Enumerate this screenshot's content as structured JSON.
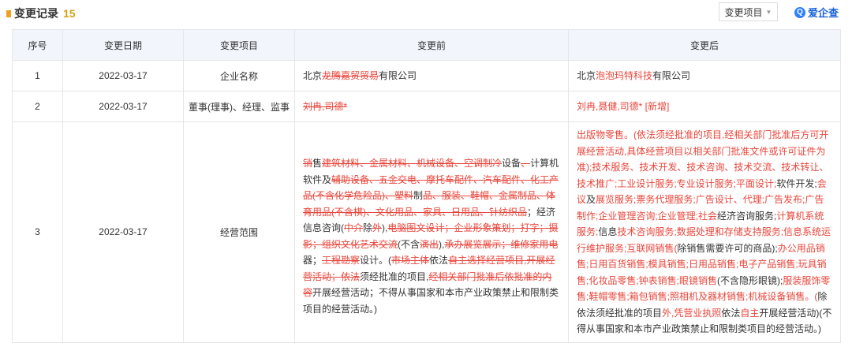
{
  "header": {
    "title": "变更记录",
    "count": "15",
    "filter_label": "变更项目",
    "brand_name": "爱企查",
    "brand_icon": "search-magnifier-icon"
  },
  "table": {
    "columns": [
      "序号",
      "变更日期",
      "变更项目",
      "变更前",
      "变更后"
    ],
    "rows": [
      {
        "no": "1",
        "date": "2022-03-17",
        "item": "企业名称",
        "before": [
          [
            "n",
            "北京"
          ],
          [
            "d",
            "龙腾嘉贸贸易"
          ],
          [
            "n",
            "有限公司"
          ]
        ],
        "after": [
          [
            "n",
            "北京"
          ],
          [
            "r",
            "泡泡玛特科技"
          ],
          [
            "n",
            "有限公司"
          ]
        ]
      },
      {
        "no": "2",
        "date": "2022-03-17",
        "item": "董事(理事)、经理、监事",
        "before": [
          [
            "d",
            "刘冉,司德*"
          ]
        ],
        "after": [
          [
            "r",
            "刘冉,聂健,司德* [新增]"
          ]
        ]
      },
      {
        "no": "3",
        "date": "2022-03-17",
        "item": "经营范围",
        "before": [
          [
            "d",
            "销"
          ],
          [
            "n",
            "售"
          ],
          [
            "d",
            "建筑材料、金属材料、机械设备、空调制冷"
          ],
          [
            "n",
            "设备"
          ],
          [
            "d",
            "、"
          ],
          [
            "n",
            "计算机软件及"
          ],
          [
            "d",
            "辅助设备、五金交电、摩托车配件、汽车配件、化工产品(不含化学危险品)、塑料"
          ],
          [
            "n",
            "制"
          ],
          [
            "d",
            "品、服装、鞋帽、金属制品、体育用品(不含棋)、文化用品、家具、日用品、针纺织品"
          ],
          [
            "n",
            "；经济信息咨询("
          ],
          [
            "d",
            "中介"
          ],
          [
            "n",
            "除"
          ],
          [
            "d",
            "外"
          ],
          [
            "n",
            "),"
          ],
          [
            "d",
            "电脑图文设计；企业形象策划；打字；摄影；组织文化艺术交流"
          ],
          [
            "n",
            "(不含"
          ],
          [
            "d",
            "演出"
          ],
          [
            "n",
            "),"
          ],
          [
            "d",
            "承办展览展示；维修家用电"
          ],
          [
            "n",
            "器；"
          ],
          [
            "d",
            "工程勘察"
          ],
          [
            "n",
            "设计。("
          ],
          [
            "d",
            "市场主体"
          ],
          [
            "n",
            "依法"
          ],
          [
            "d",
            "自主选择经营项目,开展经营活动；依法"
          ],
          [
            "n",
            "须经批准的项目,"
          ],
          [
            "d",
            "经相关部门批准后依批准的内容"
          ],
          [
            "n",
            "开展经营活动；不得从事国家和本市产业政策禁止和限制类项目的经营活动。)"
          ]
        ],
        "after": [
          [
            "r",
            "出版物零售。(依法须经批准的项目,经相关部门批准后方可开展经营活动,具体经营项目以相关部门批准文件或许可证件为准);技术服务、技术开发、技术咨询、技术交流、技术转让、技术推广;工业设计服务;专业设计服务;平面设计;"
          ],
          [
            "n",
            "软件开发;"
          ],
          [
            "r",
            "会议"
          ],
          [
            "n",
            "及"
          ],
          [
            "r",
            "展览服务;票务代理服务;广告设计、代理;广告发布;广告制作;企业管理咨询;企业管理;社会"
          ],
          [
            "n",
            "经济咨询服务;"
          ],
          [
            "r",
            "计算机系统服务;"
          ],
          [
            "n",
            "信息"
          ],
          [
            "r",
            "技术咨询服务;数据处理和存储支持服务;信息系统运行维护服务;互联网销售("
          ],
          [
            "n",
            "除销售需要许可的商品);"
          ],
          [
            "r",
            "办公用品销售;日用百货销售;模具销售;日用品销售;电子产品销售;玩具销售;化妆品零售;钟表销售;眼镜销售"
          ],
          [
            "n",
            "(不含隐形眼镜);"
          ],
          [
            "r",
            "服装服饰零售;鞋帽零售;箱包销售;照相机及器材销售;机械设备销售。("
          ],
          [
            "n",
            "除依法须经批准的项目"
          ],
          [
            "r",
            "外,凭营业执照"
          ],
          [
            "n",
            "依法"
          ],
          [
            "r",
            "自主"
          ],
          [
            "n",
            "开展经营活动)(不得从事国家和本市产业政策禁止和限制类项目的经营活动。)"
          ]
        ]
      }
    ]
  },
  "colors": {
    "accent_red": "#e8463b",
    "count_gold": "#d4a017",
    "header_bg": "#f2f6fc",
    "brand_blue": "#1a64d8"
  }
}
